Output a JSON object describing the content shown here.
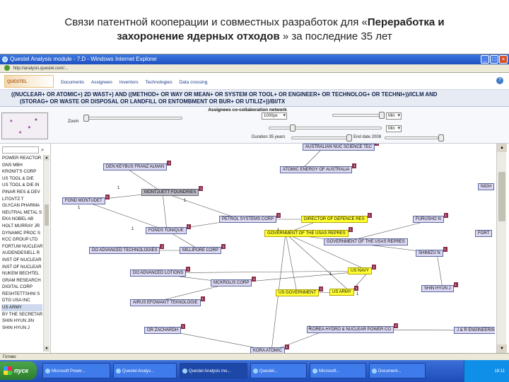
{
  "slide": {
    "title_line1_prefix": "Связи патентной кооперации и совместных разработок для «",
    "title_line1_bold": "Переработка и",
    "title_line2_bold": "захоронение ядерных отходов",
    "title_line2_suffix": "» за последние 35 лет"
  },
  "window": {
    "title": "Questel Analysis module - 7.D - Windows Internet Explorer",
    "address": "http://analysis.questel.com/...",
    "minimize": "_",
    "maximize": "□",
    "close": "×"
  },
  "app": {
    "logo": "QUESTEL",
    "tabs": [
      "Documents",
      "Assignees",
      "Inventors",
      "Technologies",
      "Data crossing"
    ],
    "help": "?"
  },
  "query": {
    "line1": "((NUCLEAR+ OR ATOMIC+) 2D WAST+) AND ((METHOD+ OR WAY OR MEAN+ OR SYSTEM OR TOOL+ OR ENGINEER+ OR TECHNOLOG+ OR TECHNI+))/ICLM AND",
    "line2": "(STORAG+ OR WASTE OR DISPOSAL OR LANDFILL OR ENTOMBMENT OR BUR+ OR UTILIZ+))/BI/TX"
  },
  "controls": {
    "panel_title": "Assignees co-collaboration network",
    "zoom_label": "Zoom",
    "size_value": "1000px",
    "min1_value": "Min",
    "min2_value": "Min",
    "duration_label": "Duration 35 years",
    "end_label": "End date 2008"
  },
  "sidebar": {
    "items": [
      "POWER REACTOR",
      "GNS MBH",
      "KRONIT'S CORP",
      "US TOOL & DIE",
      "US TOOL & DIE IN",
      "PINAR RES & DEV",
      "LITOVTZ T",
      "GLYCAN PHARMA",
      "NEUTRAL METAL S",
      "EKA NOBEL AB",
      "HOLT MURRAY JR",
      "DYNAMIC PROC S",
      "KCC GROUP LTD",
      "FORTUM NUCLEAR",
      "AUDENDESIELL R",
      "INST OF NUCLEAR",
      "INST OF NUCLEAR",
      "NUKEM BECHTEL",
      "GRAM RESEARCH",
      "DIGITAL CORP",
      "RESHTETTSHNI S",
      "DTG USA INC",
      "US ARMY",
      "BY THE SECRETAR",
      "SHIN HYUN JIN",
      "SHIN HYUN J"
    ],
    "selected_index": 22
  },
  "graph": {
    "nodes": [
      {
        "label": "AUSTRALIAN NUC SCIENCE TEC",
        "style": "lilac",
        "count": "1"
      },
      {
        "label": "DEN KEYBUS FRANZ ALMAN",
        "style": "lilac",
        "count": "1"
      },
      {
        "label": "ATOMIC ENERGY OF AUSTRALIA",
        "style": "lilac",
        "count": "1"
      },
      {
        "label": "NIGH",
        "style": "lilac",
        "count": ""
      },
      {
        "label": "MONTJUETT FOUNDRIES",
        "style": "gray",
        "count": "1"
      },
      {
        "label": "FOND MONTUDET",
        "style": "lilac",
        "count": "1"
      },
      {
        "label": "PETROL SYSTEMS CORP",
        "style": "lilac",
        "count": "1"
      },
      {
        "label": "DIRECTOR OF DEFENCE RES",
        "style": "yellow",
        "count": "1"
      },
      {
        "label": "FURUSHO N",
        "style": "lilac",
        "count": "1"
      },
      {
        "label": "FONDS TONIQUE",
        "style": "lilac",
        "count": "1"
      },
      {
        "label": "GOVERNMENT OF THE USAS REPRES",
        "style": "yellow",
        "count": "1"
      },
      {
        "label": "FORT",
        "style": "lilac",
        "count": ""
      },
      {
        "label": "GOVERNMENT OF THE USAS REPRES",
        "style": "lilac",
        "count": ""
      },
      {
        "label": "DO ADVANCED TECHNOLOGIES",
        "style": "lilac",
        "count": "1"
      },
      {
        "label": "MILLIPORE CORP",
        "style": "lilac",
        "count": "1"
      },
      {
        "label": "SHIMIZU N",
        "style": "lilac",
        "count": "1"
      },
      {
        "label": "DO ADVANCED LOTIONS",
        "style": "lilac",
        "count": "1"
      },
      {
        "label": "US NAVY",
        "style": "yellow",
        "count": "1"
      },
      {
        "label": "MCKROLIS CORP",
        "style": "lilac",
        "count": "1"
      },
      {
        "label": "SHIN HYUN J",
        "style": "lilac",
        "count": "1"
      },
      {
        "label": "US GOVERNMENT",
        "style": "yellow",
        "count": "1"
      },
      {
        "label": "US ARMY",
        "style": "yellow",
        "count": "1"
      },
      {
        "label": "AIRUS EFOWAKIT TEKNOLOGIE",
        "style": "lilac",
        "count": "1"
      },
      {
        "label": "OR ZACHARDH",
        "style": "lilac",
        "count": "1"
      },
      {
        "label": "KOREA HYDRO & NUCLEAR POWER CO",
        "style": "lilac",
        "count": "2"
      },
      {
        "label": "J & R ENGINEERING COM",
        "style": "lilac",
        "count": "1"
      },
      {
        "label": "KORA ATOMIC",
        "style": "lilac",
        "count": "1"
      }
    ],
    "edge_labels": [
      "1",
      "1",
      "1",
      "1",
      "1",
      "1",
      "2",
      "1"
    ]
  },
  "status": {
    "text": "Готово"
  },
  "taskbar": {
    "start": "пуск",
    "tasks": [
      "Microsoft Power...",
      "Questel Analys...",
      "Questel Analysis mo...",
      "Questel...",
      "Microsoft...",
      "Document..."
    ],
    "clock": "18:11"
  }
}
